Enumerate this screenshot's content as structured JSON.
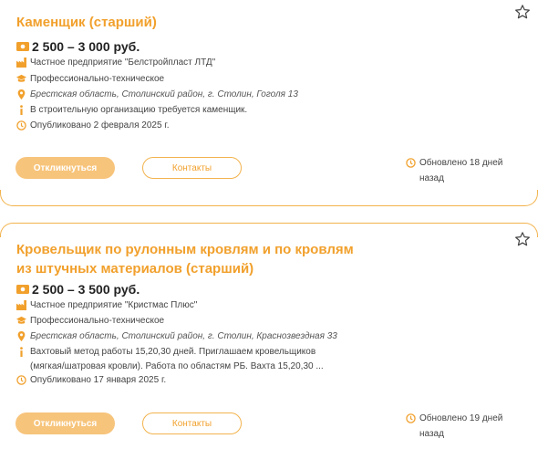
{
  "vacancies": [
    {
      "title": "Каменщик (старший)",
      "salary": "2 500 – 3 000 руб.",
      "company": "Частное предприятие \"Белстройпласт ЛТД\"",
      "education": "Профессионально-техническое",
      "address": "Брестская область, Столинский район, г. Столин, Гоголя 13",
      "description": "В строительную организацию требуется каменщик.",
      "published": "Опубликовано 2 февраля 2025 г.",
      "respond_label": "Откликнуться",
      "contacts_label": "Контакты",
      "updated": "Обновлено 18 дней назад"
    },
    {
      "title": "Кровельщик по рулонным кровлям и по кровлям из штучных материалов (старший)",
      "salary": "2 500 – 3 500 руб.",
      "company": "Частное предприятие \"Кристмас Плюс\"",
      "education": "Профессионально-техническое",
      "address": "Брестская область, Столинский район, г. Столин, Краснозвездная 33",
      "description": "Вахтовый метод работы 15,20,30 дней. Приглашаем кровельщиков (мягкая/шатровая кровли). Работа по областям РБ. Вахта 15,20,30 ...",
      "published": "Опубликовано 17 января 2025 г.",
      "respond_label": "Откликнуться",
      "contacts_label": "Контакты",
      "updated": "Обновлено 19 дней назад"
    }
  ],
  "colors": {
    "accent": "#f1a02c",
    "accent_light": "#f7c47b",
    "border": "#f2b34d",
    "text": "#333333"
  },
  "icons": {
    "star": "star-icon",
    "salary": "money-icon",
    "company": "factory-icon",
    "education": "graduation-cap-icon",
    "address": "location-pin-icon",
    "description": "info-icon",
    "published": "clock-icon",
    "updated": "clock-icon"
  }
}
